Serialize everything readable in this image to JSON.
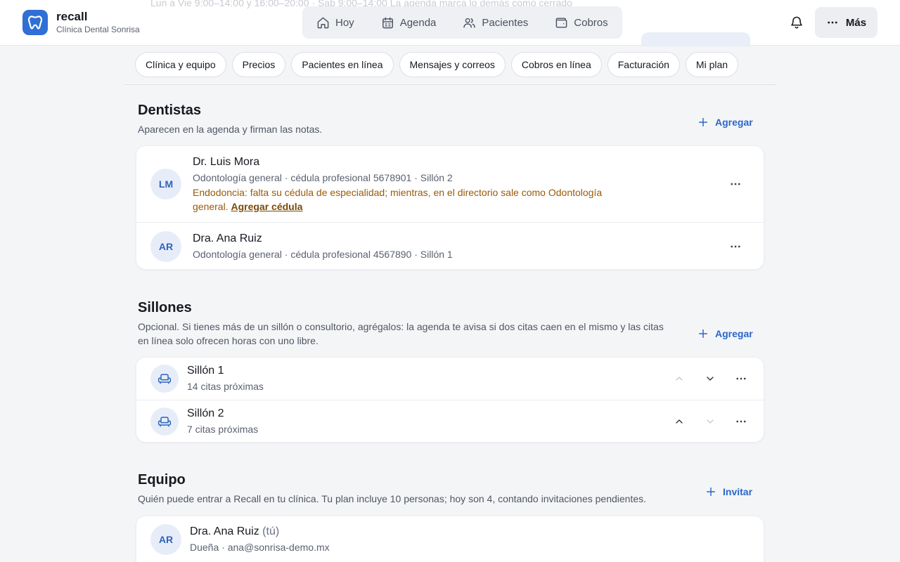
{
  "colors": {
    "accent": "#2f6fd6",
    "link": "#2b66c9",
    "warning": "#9a5a06",
    "background": "#f4f5f7"
  },
  "background_ghost": {
    "schedule_text": "Lun a Vie 9:00–14:00 y 16:00–20:00 · Sab 9:00–14:00 La agenda marca lo demás como cerrado"
  },
  "brand": {
    "name": "recall",
    "clinic": "Clínica Dental Sonrisa",
    "logo_icon": "tooth-icon"
  },
  "nav": [
    {
      "label": "Hoy",
      "icon": "home-icon"
    },
    {
      "label": "Agenda",
      "icon": "calendar-icon"
    },
    {
      "label": "Pacientes",
      "icon": "users-icon"
    },
    {
      "label": "Cobros",
      "icon": "wallet-icon"
    }
  ],
  "header": {
    "notifications_icon": "bell-icon",
    "more_label": "Más"
  },
  "tabs": [
    "Clínica y equipo",
    "Precios",
    "Pacientes en línea",
    "Mensajes y correos",
    "Cobros en línea",
    "Facturación",
    "Mi plan"
  ],
  "dentists": {
    "title": "Dentistas",
    "description": "Aparecen en la agenda y firman las notas.",
    "add_label": "Agregar",
    "items": [
      {
        "initials": "LM",
        "name": "Dr. Luis Mora",
        "meta": "Odontología general · cédula profesional 5678901 · Sillón 2",
        "warning": "Endodoncia: falta su cédula de especialidad; mientras, en el directorio sale como Odontología general.",
        "warning_link": "Agregar cédula"
      },
      {
        "initials": "AR",
        "name": "Dra. Ana Ruiz",
        "meta": "Odontología general · cédula profesional 4567890 · Sillón 1"
      }
    ]
  },
  "chairs": {
    "title": "Sillones",
    "description": "Opcional. Si tienes más de un sillón o consultorio, agrégalos: la agenda te avisa si dos citas caen en el mismo y las citas en línea solo ofrecen horas con uno libre.",
    "add_label": "Agregar",
    "items": [
      {
        "name": "Sillón 1",
        "meta": "14 citas próximas"
      },
      {
        "name": "Sillón 2",
        "meta": "7 citas próximas"
      }
    ]
  },
  "team": {
    "title": "Equipo",
    "description": "Quién puede entrar a Recall en tu clínica. Tu plan incluye 10 personas; hoy son 4, contando invitaciones pendientes.",
    "invite_label": "Invitar",
    "items": [
      {
        "initials": "AR",
        "name": "Dra. Ana Ruiz",
        "you_label": "(tú)",
        "meta": "Dueña · ana@sonrisa-demo.mx"
      }
    ]
  }
}
